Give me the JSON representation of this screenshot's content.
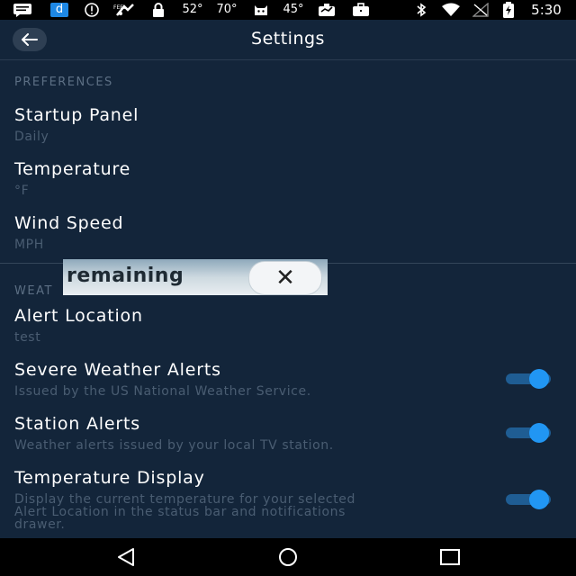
{
  "status_bar": {
    "icons": [
      "message-icon",
      "app-d-icon",
      "alert-circle-icon",
      "feelslike-icon",
      "lock-icon",
      "thermometer-icon",
      "cat-icon",
      "weather-icon",
      "briefcase-icon",
      "bluetooth-icon",
      "wifi-icon",
      "no-signal-icon",
      "battery-charging-icon"
    ],
    "temp_1": "52°",
    "temp_2": "70°",
    "temp_3": "45°",
    "feels_label": "FEEL",
    "app_letter": "d",
    "time": "5:30"
  },
  "toolbar": {
    "title": "Settings"
  },
  "preferences": {
    "header": "PREFERENCES",
    "items": [
      {
        "title": "Startup Panel",
        "subtitle": "Daily"
      },
      {
        "title": "Temperature",
        "subtitle": "°F"
      },
      {
        "title": "Wind Speed",
        "subtitle": "MPH"
      }
    ]
  },
  "weather_alerts": {
    "header": "WEAT",
    "items": [
      {
        "title": "Alert Location",
        "subtitle": "test"
      },
      {
        "title": "Severe Weather Alerts",
        "subtitle": "Issued by the US National Weather Service.",
        "enabled": true
      },
      {
        "title": "Station Alerts",
        "subtitle": "Weather alerts issued by your local TV station.",
        "enabled": true
      },
      {
        "title": "Temperature Display",
        "subtitle_lines": [
          "Display the current temperature for your selected",
          "Alert Location in the status bar and notifications",
          "drawer."
        ],
        "enabled": true
      }
    ]
  },
  "ad_overlay": {
    "text": "remaining",
    "close_symbol": "✕"
  },
  "colors": {
    "background": "#13253a",
    "toggle_on": "#2196f3",
    "section_header": "#5c6f84",
    "subtitle": "#4a5d72"
  }
}
